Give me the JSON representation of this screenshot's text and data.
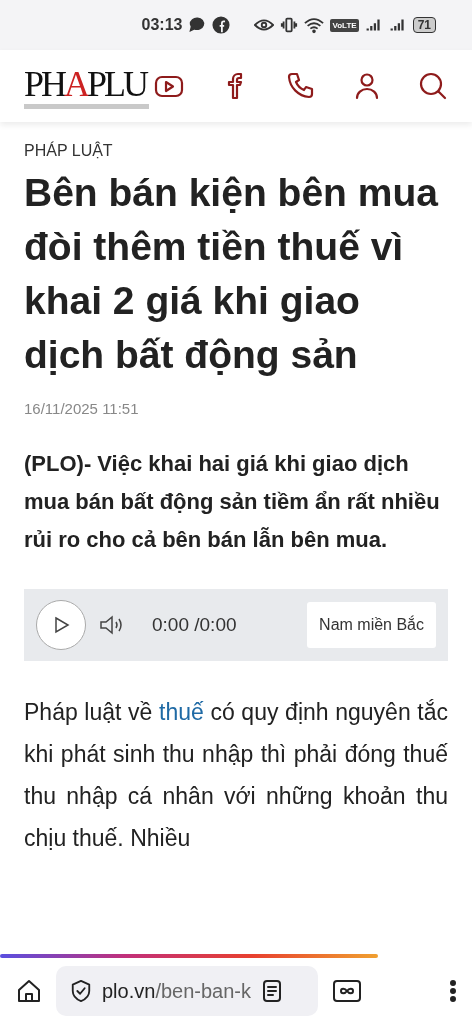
{
  "status_bar": {
    "time": "03:13",
    "battery": "71",
    "network": "VoLTE"
  },
  "header": {
    "logo": "PHAPLU"
  },
  "article": {
    "category": "PHÁP LUẬT",
    "title": "Bên bán kiện bên mua đòi thêm tiền thuế vì khai 2 giá khi giao dịch bất động sản",
    "date": "16/11/2025 11:51",
    "lead": "(PLO)- Việc khai hai giá khi giao dịch mua bán bất động sản tiềm ẩn rất nhiều rủi ro cho cả bên bán lẫn bên mua.",
    "audio": {
      "time": "0:00 /0:00",
      "voice": "Nam miền Bắc"
    },
    "body": {
      "before": "Pháp luật về ",
      "link": "thuế",
      "after": " có quy định nguyên tắc khi phát sinh thu nhập thì phải đóng thuế thu nhập cá nhân với những khoản thu chịu thuế. Nhiều"
    }
  },
  "browser": {
    "load_progress": {
      "level": 0.8
    },
    "url_host": "plo.vn",
    "url_path": "/ben-ban-k"
  }
}
